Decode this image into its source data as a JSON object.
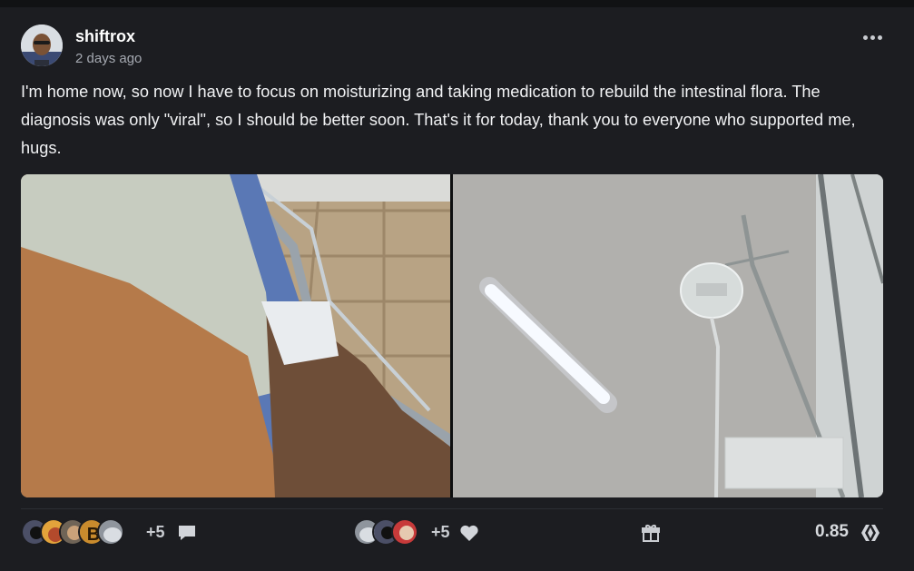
{
  "post": {
    "author": "shiftrox",
    "time": "2 days ago",
    "body": "I'm home now, so now I have to focus on moisturizing and taking medication to rebuild the intestinal flora. The diagnosis was only \"viral\", so I should be better soon. That's it for today, thank you to everyone who supported me, hugs."
  },
  "actions": {
    "comments_extra": "+5",
    "votes_extra": "+5",
    "payout": "0.85"
  },
  "icons": {
    "more": "more-horizontal-icon",
    "comment": "comment-icon",
    "heart": "heart-icon",
    "gift": "gift-icon",
    "currency": "hive-logo-icon"
  },
  "colors": {
    "background": "#1c1d21",
    "text": "#f2f3f5",
    "muted": "#a5a9b1"
  }
}
